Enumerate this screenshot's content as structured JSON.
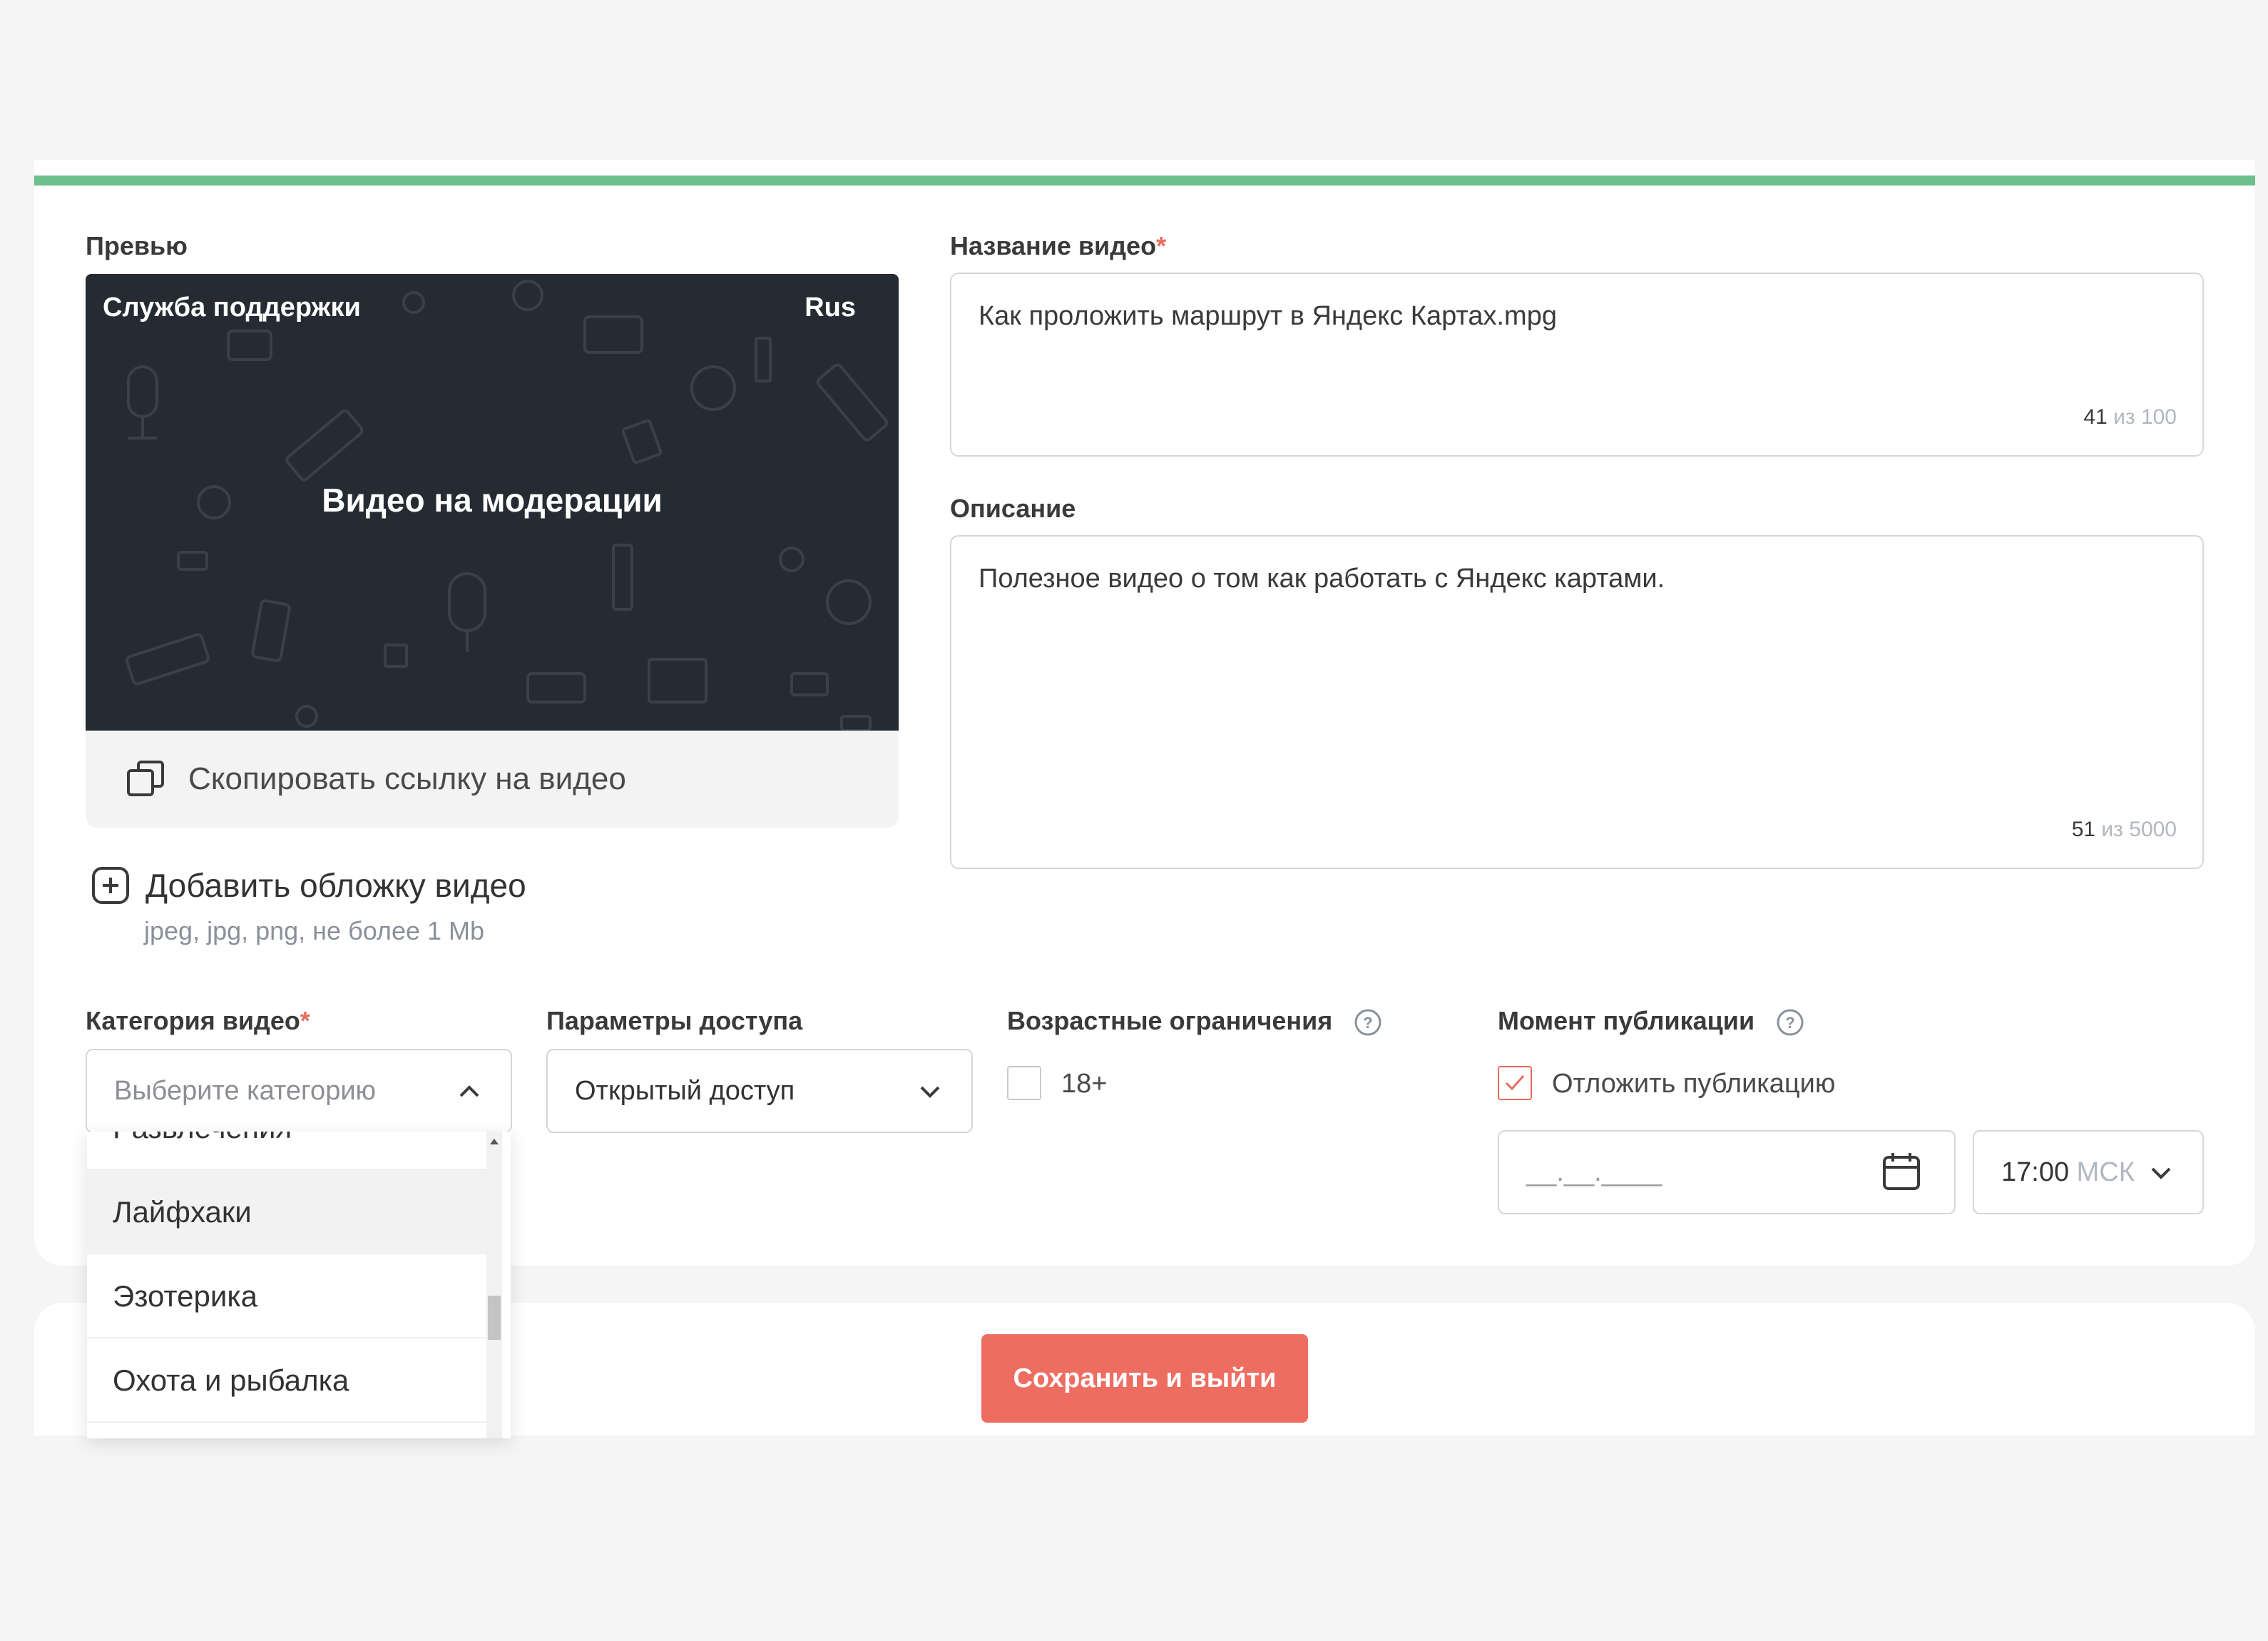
{
  "preview": {
    "label": "Превью",
    "channel": "Служба поддержки",
    "lang": "Rus",
    "status": "Видео на модерации",
    "copy_link": "Скопировать ссылку на видео"
  },
  "cover": {
    "add_label": "Добавить обложку видео",
    "hint": "jpeg, jpg, png, не более 1 Mb"
  },
  "title_field": {
    "label": "Название видео",
    "required_mark": "*",
    "value": "Как проложить маршрут в Яндекс Картах.mpg",
    "count": "41",
    "of_max": "из 100"
  },
  "description_field": {
    "label": "Описание",
    "value": "Полезное видео о том как работать с Яндекс картами.",
    "count": "51",
    "of_max": "из 5000"
  },
  "category": {
    "label": "Категория видео",
    "required_mark": "*",
    "placeholder": "Выберите категорию",
    "options_partial_top": "Развлечения",
    "options": [
      "Лайфхаки",
      "Эзотерика",
      "Охота и рыбалка"
    ]
  },
  "access": {
    "label": "Параметры доступа",
    "value": "Открытый доступ"
  },
  "age": {
    "label": "Возрастные ограничения",
    "option": "18+"
  },
  "publish": {
    "label": "Момент публикации",
    "defer_label": "Отложить публикацию",
    "date_mask": "__.__.____",
    "time": "17:00",
    "tz": "МСК"
  },
  "actions": {
    "save": "Сохранить и выйти"
  },
  "colors": {
    "accent_green": "#6bc08b",
    "accent_red": "#ee6d61",
    "preview_bg": "#262b33"
  }
}
